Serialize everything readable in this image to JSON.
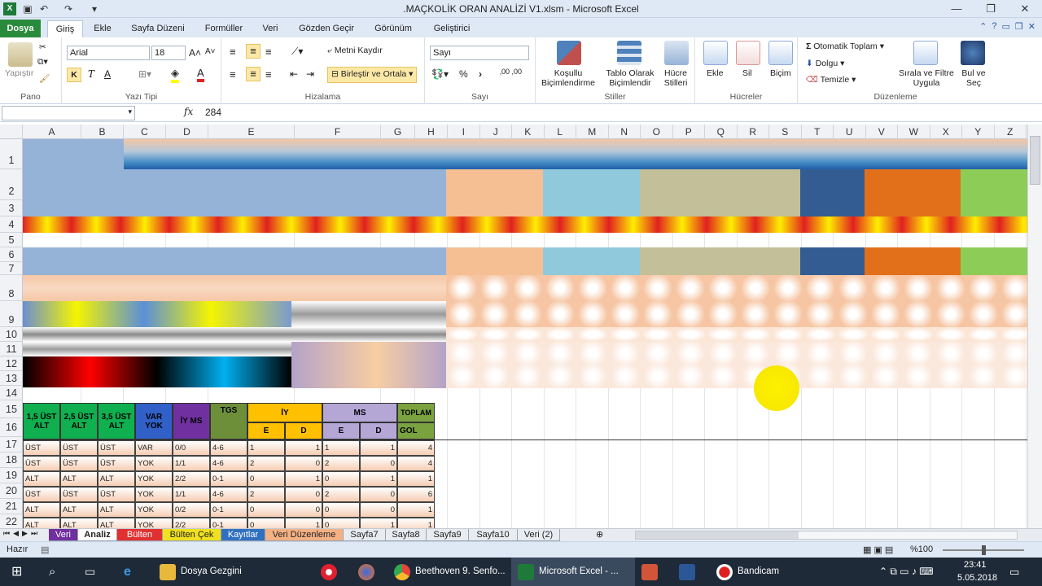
{
  "window": {
    "title": ".MAÇKOLİK ORAN ANALİZİ V1.xlsm  -  Microsoft Excel"
  },
  "ribbon_tabs": [
    "Dosya",
    "Giriş",
    "Ekle",
    "Sayfa Düzeni",
    "Formüller",
    "Veri",
    "Gözden Geçir",
    "Görünüm",
    "Geliştirici"
  ],
  "ribbon": {
    "pano": {
      "label": "Pano",
      "paste": "Yapıştır"
    },
    "font": {
      "label": "Yazı Tipi",
      "name": "Arial",
      "size": "18",
      "bold": "K",
      "italic": "T",
      "underline": "A"
    },
    "align": {
      "label": "Hizalama",
      "wrap": "Metni Kaydır",
      "merge": "Birleştir ve Ortala"
    },
    "number": {
      "label": "Sayı",
      "format": "Sayı",
      "percent": "%",
      "comma": "›",
      "decimals": "‚00 ,00"
    },
    "styles": {
      "label": "Stiller",
      "cond": "Koşullu Biçimlendirme",
      "table": "Tablo Olarak Biçimlendir",
      "cell": "Hücre Stilleri"
    },
    "cells": {
      "label": "Hücreler",
      "insert": "Ekle",
      "delete": "Sil",
      "format": "Biçim"
    },
    "edit": {
      "label": "Düzenleme",
      "autosum": "Otomatik Toplam",
      "fill": "Dolgu",
      "clear": "Temizle",
      "sort": "Sırala ve Filtre Uygula",
      "find": "Bul ve Seç"
    }
  },
  "formula_bar": {
    "fx": "fx",
    "value": "284"
  },
  "columns": [
    "A",
    "B",
    "C",
    "D",
    "E",
    "F",
    "G",
    "H",
    "I",
    "J",
    "K",
    "L",
    "M",
    "N",
    "O",
    "P",
    "Q",
    "R",
    "S",
    "T",
    "U",
    "V",
    "W",
    "X",
    "Y",
    "Z"
  ],
  "rows": [
    "1",
    "2",
    "3",
    "4",
    "5",
    "6",
    "7",
    "8",
    "9",
    "10",
    "11",
    "12",
    "13",
    "14",
    "15",
    "16",
    "17",
    "18",
    "19",
    "20",
    "21",
    "22"
  ],
  "table": {
    "headers": {
      "h15": "1,5 ÜST ALT",
      "h25": "2,5 ÜST ALT",
      "h35": "3,5 ÜST ALT",
      "varyok": "VAR YOK",
      "iyms": "İY MS",
      "tgs": "TGS",
      "iy": "İY",
      "ms": "MS",
      "toplam": "TOPLAM",
      "gol": "GOL",
      "e": "E",
      "d": "D"
    },
    "data_rows": [
      [
        "ÜST",
        "ÜST",
        "ÜST",
        "VAR",
        "0/0",
        "4-6",
        "1",
        "1",
        "1",
        "1",
        "4"
      ],
      [
        "ÜST",
        "ÜST",
        "ÜST",
        "YOK",
        "1/1",
        "4-6",
        "2",
        "0",
        "2",
        "0",
        "4"
      ],
      [
        "ALT",
        "ALT",
        "ALT",
        "YOK",
        "2/2",
        "0-1",
        "0",
        "1",
        "0",
        "1",
        "1"
      ],
      [
        "ÜST",
        "ÜST",
        "ÜST",
        "YOK",
        "1/1",
        "4-6",
        "2",
        "0",
        "2",
        "0",
        "6"
      ],
      [
        "ALT",
        "ALT",
        "ALT",
        "YOK",
        "0/2",
        "0-1",
        "0",
        "0",
        "0",
        "0",
        "1"
      ],
      [
        "ALT",
        "ALT",
        "ALT",
        "YOK",
        "2/2",
        "0-1",
        "0",
        "1",
        "0",
        "1",
        "1"
      ]
    ]
  },
  "sheet_tabs": [
    {
      "name": "Veri",
      "color": "#7030a0"
    },
    {
      "name": "Analiz",
      "color": "#ffffff"
    },
    {
      "name": "Bülten",
      "color": "#e03030"
    },
    {
      "name": "Bülten Çek",
      "color": "#f0e020"
    },
    {
      "name": "Kayıtlar",
      "color": "#3070c0"
    },
    {
      "name": "Veri Düzenleme",
      "color": "#f4b183"
    },
    {
      "name": "Sayfa7",
      "color": "#e8ecf1"
    },
    {
      "name": "Sayfa8",
      "color": "#e8ecf1"
    },
    {
      "name": "Sayfa9",
      "color": "#e8ecf1"
    },
    {
      "name": "Sayfa10",
      "color": "#e8ecf1"
    },
    {
      "name": "Veri (2)",
      "color": "#e8ecf1"
    }
  ],
  "status": {
    "ready": "Hazır",
    "zoom": "%100"
  },
  "taskbar": {
    "items": [
      "Dosya Gezgini",
      "Beethoven 9. Senfo...",
      "Microsoft Excel - ...",
      "Bandicam"
    ],
    "time": "23:41",
    "date": "5.05.2018"
  }
}
